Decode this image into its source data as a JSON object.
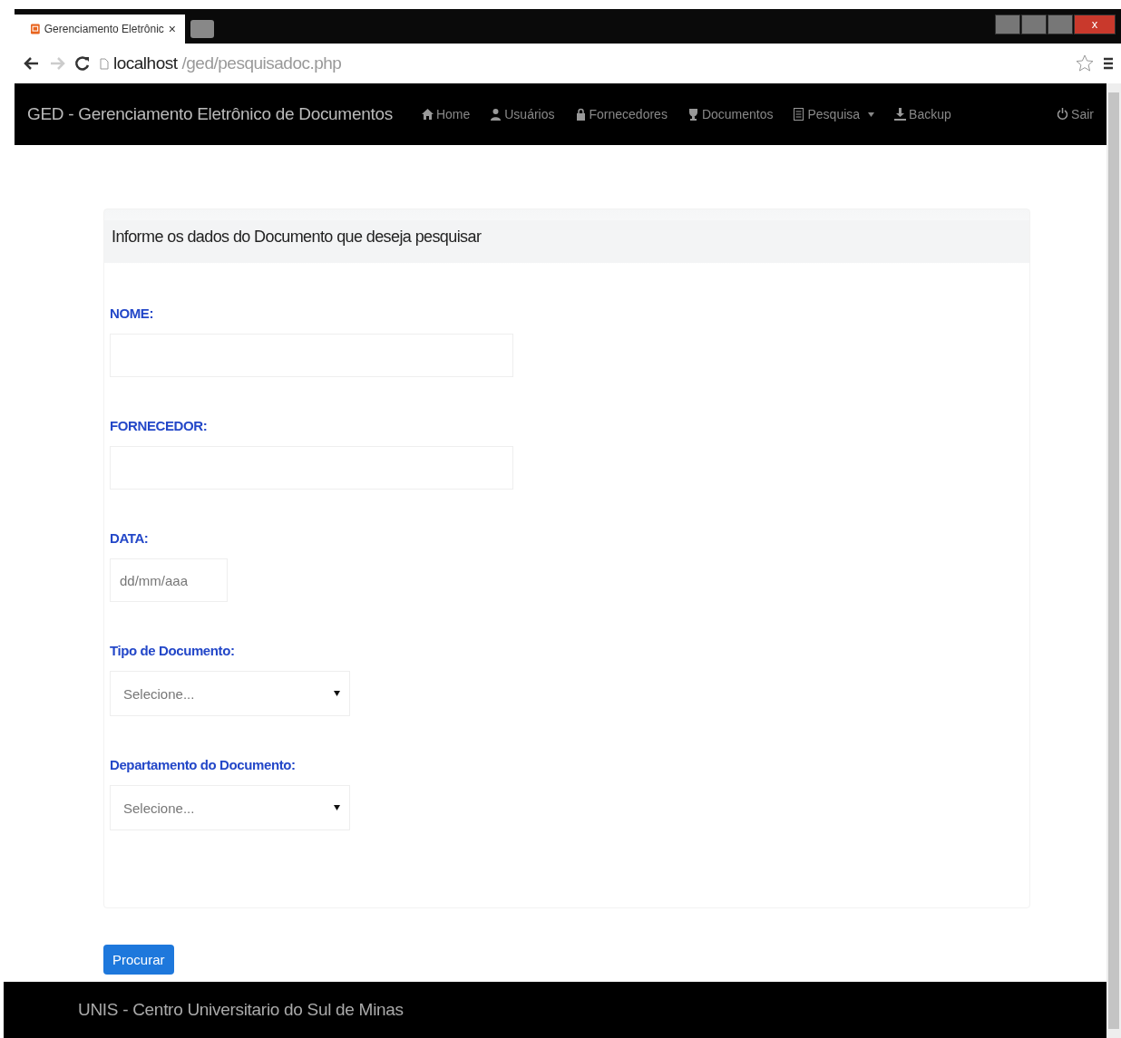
{
  "browser": {
    "tab_title": "Gerenciamento Eletrônic",
    "tab_close": "×",
    "url_host": "localhost",
    "url_path": "/ged/pesquisadoc.php",
    "window_close": "x"
  },
  "navbar": {
    "brand": "GED - Gerenciamento Eletrônico de Documentos",
    "items": [
      {
        "label": "Home",
        "dropdown": false
      },
      {
        "label": "Usuários",
        "dropdown": false
      },
      {
        "label": "Fornecedores",
        "dropdown": false
      },
      {
        "label": "Documentos",
        "dropdown": false
      },
      {
        "label": "Pesquisa",
        "dropdown": true
      },
      {
        "label": "Backup",
        "dropdown": false
      }
    ],
    "logout": "Sair"
  },
  "form": {
    "heading": "Informe os dados do Documento que deseja pesquisar",
    "fields": [
      {
        "kind": "text",
        "label": "NOME:"
      },
      {
        "kind": "text",
        "label": "FORNECEDOR:"
      },
      {
        "kind": "date",
        "label": "DATA:",
        "placeholder": "dd/mm/aaa"
      },
      {
        "kind": "select",
        "label": "Tipo de Documento:",
        "value": "Selecione..."
      },
      {
        "kind": "select",
        "label": "Departamento do Documento:",
        "value": "Selecione..."
      }
    ],
    "submit": "Procurar"
  },
  "footer": {
    "text": "UNIS - Centro Universitario do Sul de Minas"
  }
}
